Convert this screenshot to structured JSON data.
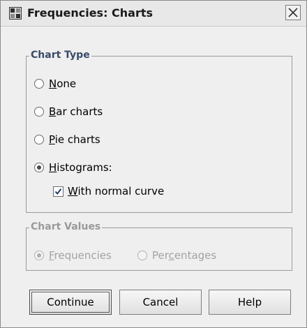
{
  "window": {
    "title": "Frequencies: Charts"
  },
  "chart_type": {
    "legend": "Chart Type",
    "options": [
      {
        "label_u": "N",
        "label_rest": "one",
        "pre": "",
        "checked": false
      },
      {
        "label_u": "B",
        "label_rest": "ar charts",
        "pre": "",
        "checked": false
      },
      {
        "label_u": "P",
        "label_rest": "ie charts",
        "pre": "",
        "checked": false
      },
      {
        "label_u": "H",
        "label_rest": "istograms:",
        "pre": "",
        "checked": true
      }
    ],
    "normal_curve": {
      "label_u": "W",
      "label_rest": "ith normal curve",
      "checked": true
    }
  },
  "chart_values": {
    "legend": "Chart Values",
    "frequencies": {
      "label_u": "F",
      "label_rest": "requencies",
      "checked": true,
      "enabled": false
    },
    "percentages": {
      "label_pre": "Per",
      "label_u": "c",
      "label_rest": "entages",
      "checked": false,
      "enabled": false
    }
  },
  "buttons": {
    "continue": "Continue",
    "cancel": "Cancel",
    "help": "Help"
  }
}
